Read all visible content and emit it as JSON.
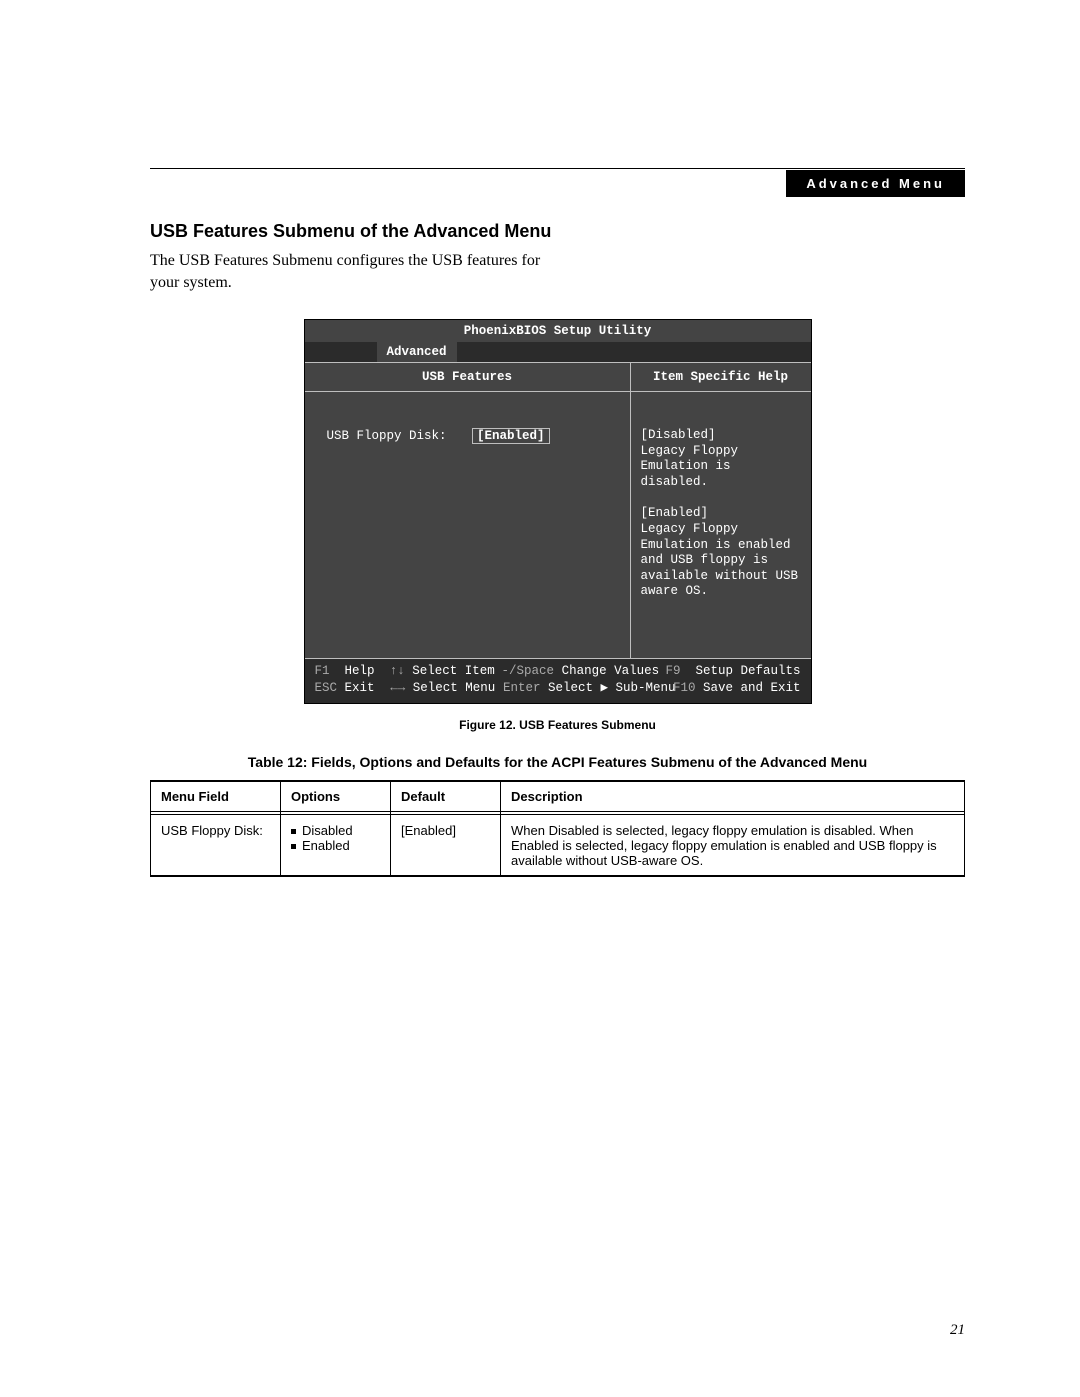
{
  "header": {
    "tab_label": "Advanced Menu"
  },
  "section": {
    "title": "USB Features Submenu of the Advanced Menu",
    "intro": "The USB Features Submenu configures the USB features for your system."
  },
  "bios": {
    "utility_title": "PhoenixBIOS Setup Utility",
    "active_tab": "Advanced",
    "left_title": "USB Features",
    "right_title": "Item Specific Help",
    "field_label": "USB Floppy Disk:",
    "field_value": "[Enabled]",
    "help_text": "[Disabled]\nLegacy Floppy Emulation is disabled.\n\n[Enabled]\nLegacy Floppy Emulation is enabled and USB floppy is available without USB aware OS.",
    "footer": {
      "r1": {
        "k1": "F1",
        "v1": "Help",
        "k2": "↑↓",
        "v2": "Select Item",
        "k3": "-/Space",
        "v3": "Change Values",
        "k4": "F9",
        "v4": "Setup Defaults"
      },
      "r2": {
        "k1": "ESC",
        "v1": "Exit",
        "k2": "←→",
        "v2": "Select Menu",
        "k3": "Enter",
        "v3": "Select ▶ Sub-Menu",
        "k4": "F10",
        "v4": "Save and Exit"
      }
    }
  },
  "figure_caption": "Figure 12. USB Features Submenu",
  "table_caption": "Table 12: Fields, Options and Defaults for the ACPI Features Submenu of the Advanced Menu",
  "table": {
    "headers": [
      "Menu Field",
      "Options",
      "Default",
      "Description"
    ],
    "rows": [
      {
        "menu_field": "USB Floppy Disk:",
        "options": [
          "Disabled",
          "Enabled"
        ],
        "default": "[Enabled]",
        "description": "When Disabled is selected, legacy floppy emulation is disabled. When Enabled is selected, legacy floppy emulation is enabled and USB floppy is available without USB-aware OS."
      }
    ]
  },
  "page_number": "21"
}
